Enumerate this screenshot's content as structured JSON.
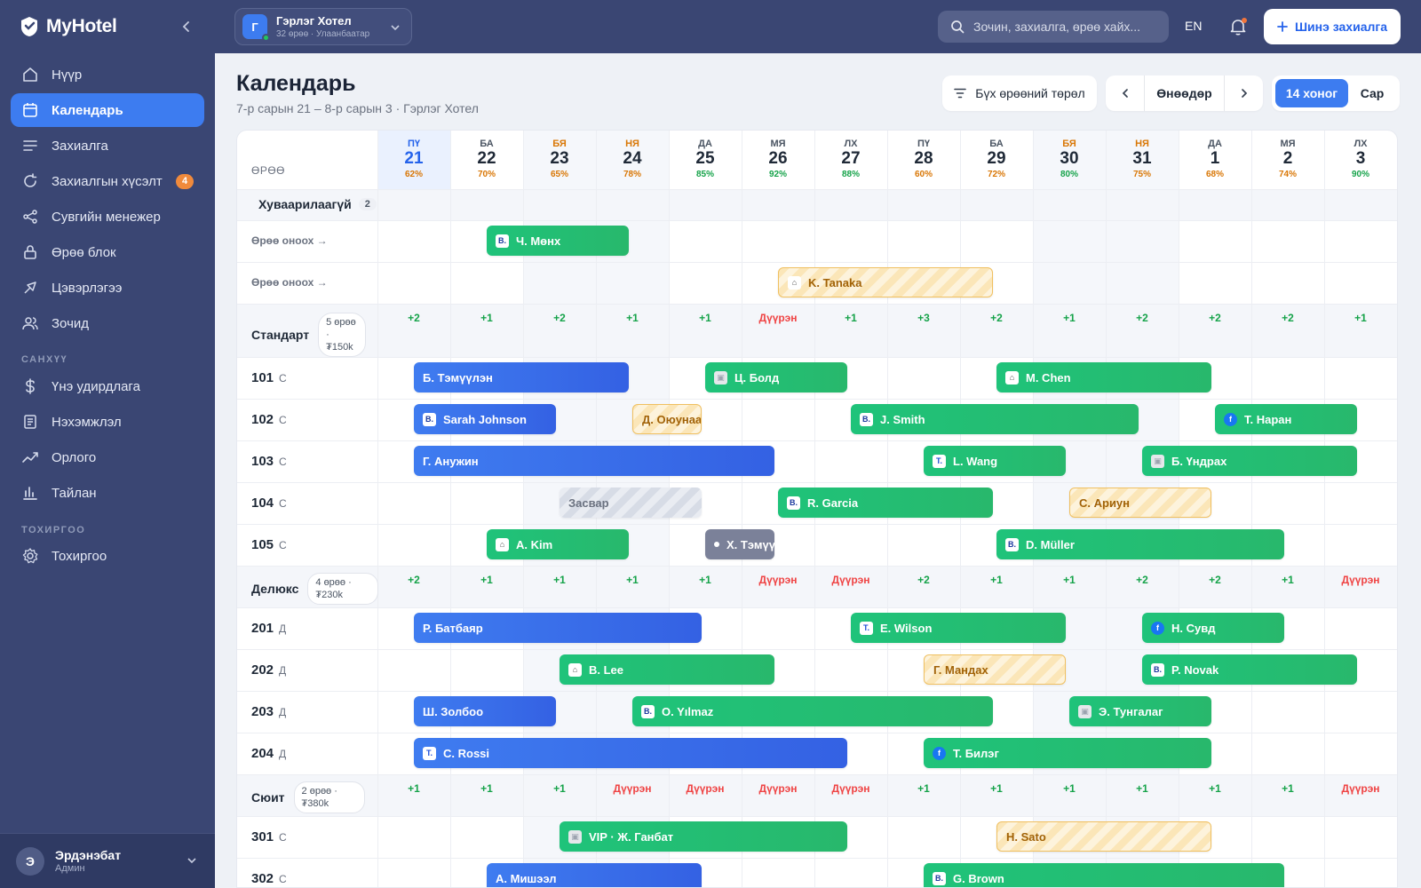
{
  "app": {
    "name": "MyHotel"
  },
  "sidebar": {
    "items": [
      {
        "label": "Нүүр",
        "icon": "home-icon",
        "key": "home"
      },
      {
        "label": "Календарь",
        "icon": "calendar-icon",
        "key": "calendar",
        "active": true
      },
      {
        "label": "Захиалга",
        "icon": "list-icon",
        "key": "bookings"
      },
      {
        "label": "Захиалгын хүсэлт",
        "icon": "refresh-icon",
        "key": "requests",
        "badge": "4"
      },
      {
        "label": "Сувгийн менежер",
        "icon": "share-icon",
        "key": "channels"
      },
      {
        "label": "Өрөө блок",
        "icon": "lock-icon",
        "key": "blocks"
      },
      {
        "label": "Цэвэрлэгээ",
        "icon": "broom-icon",
        "key": "housekeeping"
      },
      {
        "label": "Зочид",
        "icon": "users-icon",
        "key": "guests"
      }
    ],
    "finance_title": "САНХҮҮ",
    "finance_items": [
      {
        "label": "Үнэ удирдлага",
        "icon": "dollar-icon",
        "key": "pricing"
      },
      {
        "label": "Нэхэмжлэл",
        "icon": "invoice-icon",
        "key": "invoices"
      },
      {
        "label": "Орлого",
        "icon": "trend-icon",
        "key": "revenue"
      },
      {
        "label": "Тайлан",
        "icon": "chart-icon",
        "key": "reports"
      }
    ],
    "settings_title": "ТОХИРГОО",
    "settings_items": [
      {
        "label": "Тохиргоо",
        "icon": "gear-icon",
        "key": "settings"
      }
    ],
    "user": {
      "initial": "Э",
      "name": "Эрдэнэбат",
      "role": "Админ"
    }
  },
  "topbar": {
    "hotel": {
      "initial": "Г",
      "name": "Гэрлэг Хотел",
      "sub": "32 өрөө · Улаанбаатар"
    },
    "search_placeholder": "Зочин, захиалга, өрөө хайх...",
    "lang": "EN",
    "new_booking": "Шинэ захиалга"
  },
  "page": {
    "title": "Календарь",
    "subtitle": "7-р сарын 21 – 8-р сарын 3 · Гэрлэг Хотел",
    "filter": "Бүх өрөөний төрөл",
    "today": "Өнөөдөр",
    "view_active": "14 хоног",
    "view_other": "Сар"
  },
  "grid": {
    "room_header": "ӨРӨӨ",
    "days": [
      {
        "dow": "ПҮ",
        "num": "21",
        "occ": "62%",
        "today": true
      },
      {
        "dow": "БА",
        "num": "22",
        "occ": "70%"
      },
      {
        "dow": "БЯ",
        "num": "23",
        "occ": "65%",
        "weekend": true
      },
      {
        "dow": "НЯ",
        "num": "24",
        "occ": "78%",
        "weekend": true
      },
      {
        "dow": "ДА",
        "num": "25",
        "occ": "85%"
      },
      {
        "dow": "МЯ",
        "num": "26",
        "occ": "92%"
      },
      {
        "dow": "ЛХ",
        "num": "27",
        "occ": "88%"
      },
      {
        "dow": "ПҮ",
        "num": "28",
        "occ": "60%"
      },
      {
        "dow": "БА",
        "num": "29",
        "occ": "72%"
      },
      {
        "dow": "БЯ",
        "num": "30",
        "occ": "80%",
        "weekend": true
      },
      {
        "dow": "НЯ",
        "num": "31",
        "occ": "75%",
        "weekend": true
      },
      {
        "dow": "ДА",
        "num": "1",
        "occ": "68%"
      },
      {
        "dow": "МЯ",
        "num": "2",
        "occ": "74%"
      },
      {
        "dow": "ЛХ",
        "num": "3",
        "occ": "90%"
      }
    ],
    "unassigned": {
      "label": "Хуваарилаагүй",
      "count": "2",
      "assign_label": "Өрөө оноох →"
    },
    "full_label": "Дүүрэн"
  },
  "sections": [
    {
      "type": "unassigned",
      "rows": [
        {
          "assign": true,
          "bookings": [
            {
              "name": "Ч. Мөнх",
              "start": 1,
              "end": 3,
              "style": "green",
              "src": "booking"
            }
          ]
        },
        {
          "assign": true,
          "bookings": [
            {
              "name": "K. Tanaka",
              "start": 5,
              "end": 8,
              "style": "pending",
              "src": "airbnb"
            }
          ]
        }
      ]
    },
    {
      "type": "roomtype",
      "name": "Стандарт",
      "pill": "5 өрөө · ₮150k",
      "avail": [
        "+2",
        "+1",
        "+2",
        "+1",
        "+1",
        "full",
        "+1",
        "+3",
        "+2",
        "+1",
        "+2",
        "+2",
        "+2",
        "+1"
      ],
      "rows": [
        {
          "room": "101",
          "t": "С",
          "bookings": [
            {
              "name": "Б. Тэмүүлэн",
              "start": 0,
              "end": 3,
              "style": "blue"
            },
            {
              "name": "Ц. Болд",
              "start": 4,
              "end": 6,
              "style": "green",
              "src": "web"
            },
            {
              "name": "M. Chen",
              "start": 8,
              "end": 11,
              "style": "green",
              "src": "airbnb"
            }
          ]
        },
        {
          "room": "102",
          "t": "С",
          "bookings": [
            {
              "name": "Sarah Johnson",
              "start": 0,
              "end": 2,
              "style": "blue",
              "src": "booking"
            },
            {
              "name": "Д. Оюунаа",
              "start": 3,
              "end": 4,
              "style": "pending"
            },
            {
              "name": "J. Smith",
              "start": 6,
              "end": 10,
              "style": "green",
              "src": "booking"
            },
            {
              "name": "Т. Наран",
              "start": 11,
              "end": 13,
              "style": "green",
              "src": "fb"
            }
          ]
        },
        {
          "room": "103",
          "t": "С",
          "bookings": [
            {
              "name": "Г. Анужин",
              "start": 0,
              "end": 5,
              "style": "blue"
            },
            {
              "name": "L. Wang",
              "start": 7,
              "end": 9,
              "style": "green",
              "src": "trip"
            },
            {
              "name": "Б. Үндрах",
              "start": 10,
              "end": 13,
              "style": "green",
              "src": "web"
            }
          ]
        },
        {
          "room": "104",
          "t": "С",
          "bookings": [
            {
              "name": "Засвар",
              "start": 2,
              "end": 4,
              "style": "maint"
            },
            {
              "name": "R. Garcia",
              "start": 5,
              "end": 8,
              "style": "green",
              "src": "booking"
            },
            {
              "name": "С. Ариун",
              "start": 9,
              "end": 11,
              "style": "pending"
            }
          ]
        },
        {
          "room": "105",
          "t": "С",
          "bookings": [
            {
              "name": "A. Kim",
              "start": 1,
              "end": 3,
              "style": "green",
              "src": "airbnb"
            },
            {
              "name": "Х. Тэмүүж",
              "start": 4,
              "end": 5,
              "style": "gray",
              "src": "dot"
            },
            {
              "name": "D. Müller",
              "start": 8,
              "end": 12,
              "style": "green",
              "src": "booking"
            }
          ]
        }
      ]
    },
    {
      "type": "roomtype",
      "name": "Делюкс",
      "pill": "4 өрөө · ₮230k",
      "avail": [
        "+2",
        "+1",
        "+1",
        "+1",
        "+1",
        "full",
        "full",
        "+2",
        "+1",
        "+1",
        "+2",
        "+2",
        "+1",
        "full"
      ],
      "rows": [
        {
          "room": "201",
          "t": "Д",
          "bookings": [
            {
              "name": "Р. Батбаяр",
              "start": 0,
              "end": 4,
              "style": "blue"
            },
            {
              "name": "E. Wilson",
              "start": 6,
              "end": 9,
              "style": "green",
              "src": "trip"
            },
            {
              "name": "Н. Сувд",
              "start": 10,
              "end": 12,
              "style": "green",
              "src": "fb"
            }
          ]
        },
        {
          "room": "202",
          "t": "Д",
          "bookings": [
            {
              "name": "B. Lee",
              "start": 2,
              "end": 5,
              "style": "green",
              "src": "airbnb"
            },
            {
              "name": "Г. Мандах",
              "start": 7,
              "end": 9,
              "style": "pending"
            },
            {
              "name": "P. Novak",
              "start": 10,
              "end": 13,
              "style": "green",
              "src": "booking"
            }
          ]
        },
        {
          "room": "203",
          "t": "Д",
          "bookings": [
            {
              "name": "Ш. Золбоо",
              "start": 0,
              "end": 2,
              "style": "blue"
            },
            {
              "name": "O. Yılmaz",
              "start": 3,
              "end": 8,
              "style": "green",
              "src": "booking"
            },
            {
              "name": "Э. Тунгалаг",
              "start": 9,
              "end": 11,
              "style": "green",
              "src": "web"
            }
          ]
        },
        {
          "room": "204",
          "t": "Д",
          "bookings": [
            {
              "name": "C. Rossi",
              "start": 0,
              "end": 6,
              "style": "blue",
              "src": "trip"
            },
            {
              "name": "Т. Билэг",
              "start": 7,
              "end": 11,
              "style": "green",
              "src": "fb"
            }
          ]
        }
      ]
    },
    {
      "type": "roomtype",
      "name": "Сюит",
      "pill": "2 өрөө · ₮380k",
      "avail": [
        "+1",
        "+1",
        "+1",
        "full",
        "full",
        "full",
        "full",
        "+1",
        "+1",
        "+1",
        "+1",
        "+1",
        "+1",
        "full"
      ],
      "rows": [
        {
          "room": "301",
          "t": "С",
          "bookings": [
            {
              "name": "VIP · Ж. Ганбат",
              "start": 2,
              "end": 6,
              "style": "green",
              "src": "web"
            },
            {
              "name": "H. Sato",
              "start": 8,
              "end": 11,
              "style": "pending"
            }
          ]
        },
        {
          "room": "302",
          "t": "С",
          "bookings": [
            {
              "name": "А. Мишээл",
              "start": 1,
              "end": 4,
              "style": "blue"
            },
            {
              "name": "G. Brown",
              "start": 7,
              "end": 12,
              "style": "green",
              "src": "booking"
            }
          ]
        }
      ]
    }
  ]
}
